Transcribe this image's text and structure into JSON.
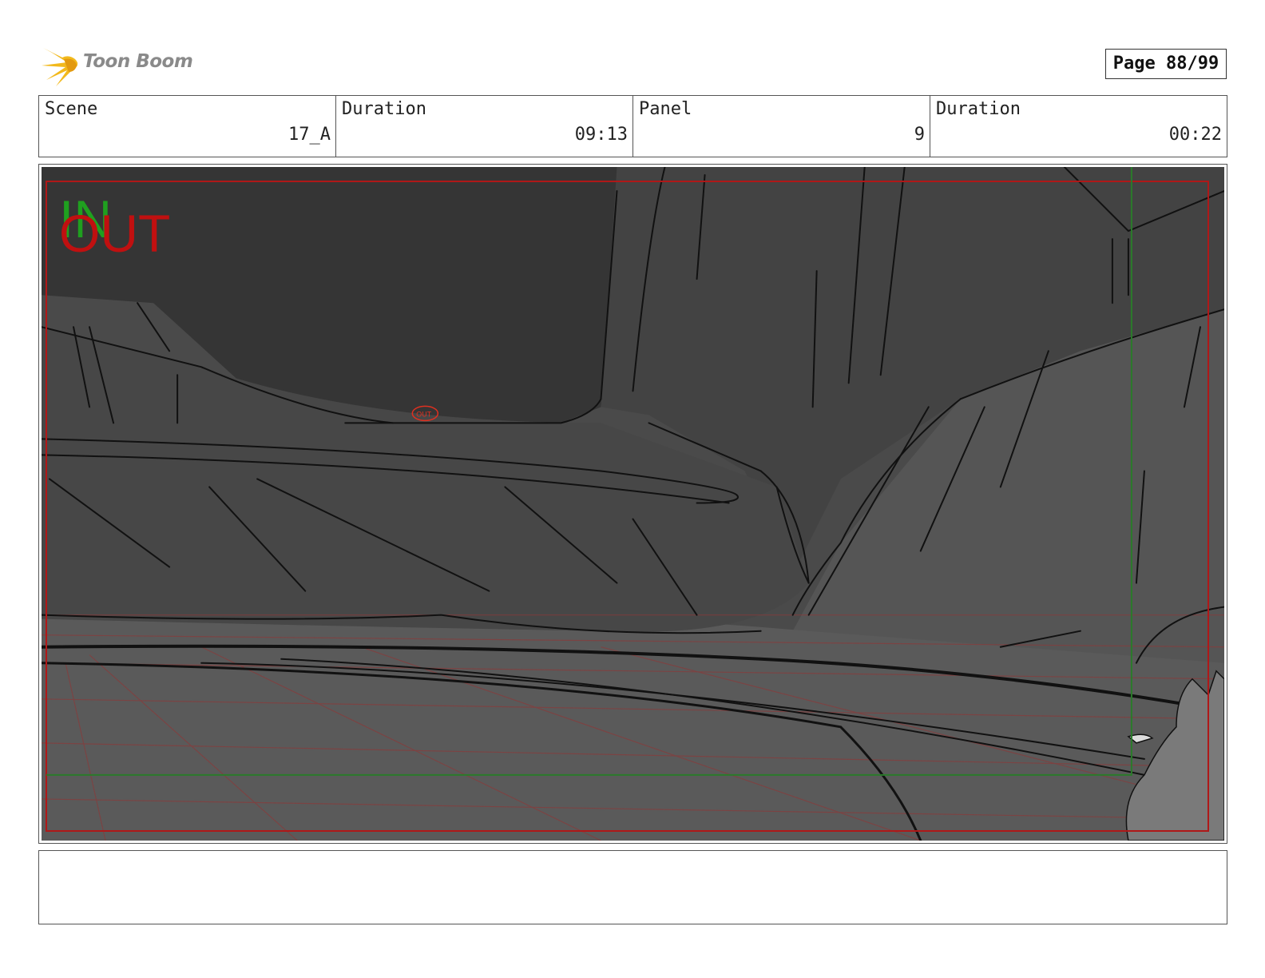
{
  "header": {
    "logo_text": "Toon Boom",
    "page_label": "Page 88/99"
  },
  "info": {
    "scene_label": "Scene",
    "scene_value": "17_A",
    "duration_label": "Duration",
    "duration_value": "09:13",
    "panel_label": "Panel",
    "panel_value": "9",
    "panel_duration_label": "Duration",
    "panel_duration_value": "00:22"
  },
  "panel": {
    "in_marker": "IN",
    "out_marker": "OUT",
    "small_marker": "OUT"
  },
  "notes": {
    "text": ""
  },
  "colors": {
    "logo_flame": "#f2b91c",
    "in_green": "#1fa01f",
    "out_red": "#c01010",
    "safe_frame_red": "#b01818",
    "safe_frame_green": "#2a7a2a"
  },
  "icons": {
    "logo": "toon-boom-flame-icon"
  }
}
